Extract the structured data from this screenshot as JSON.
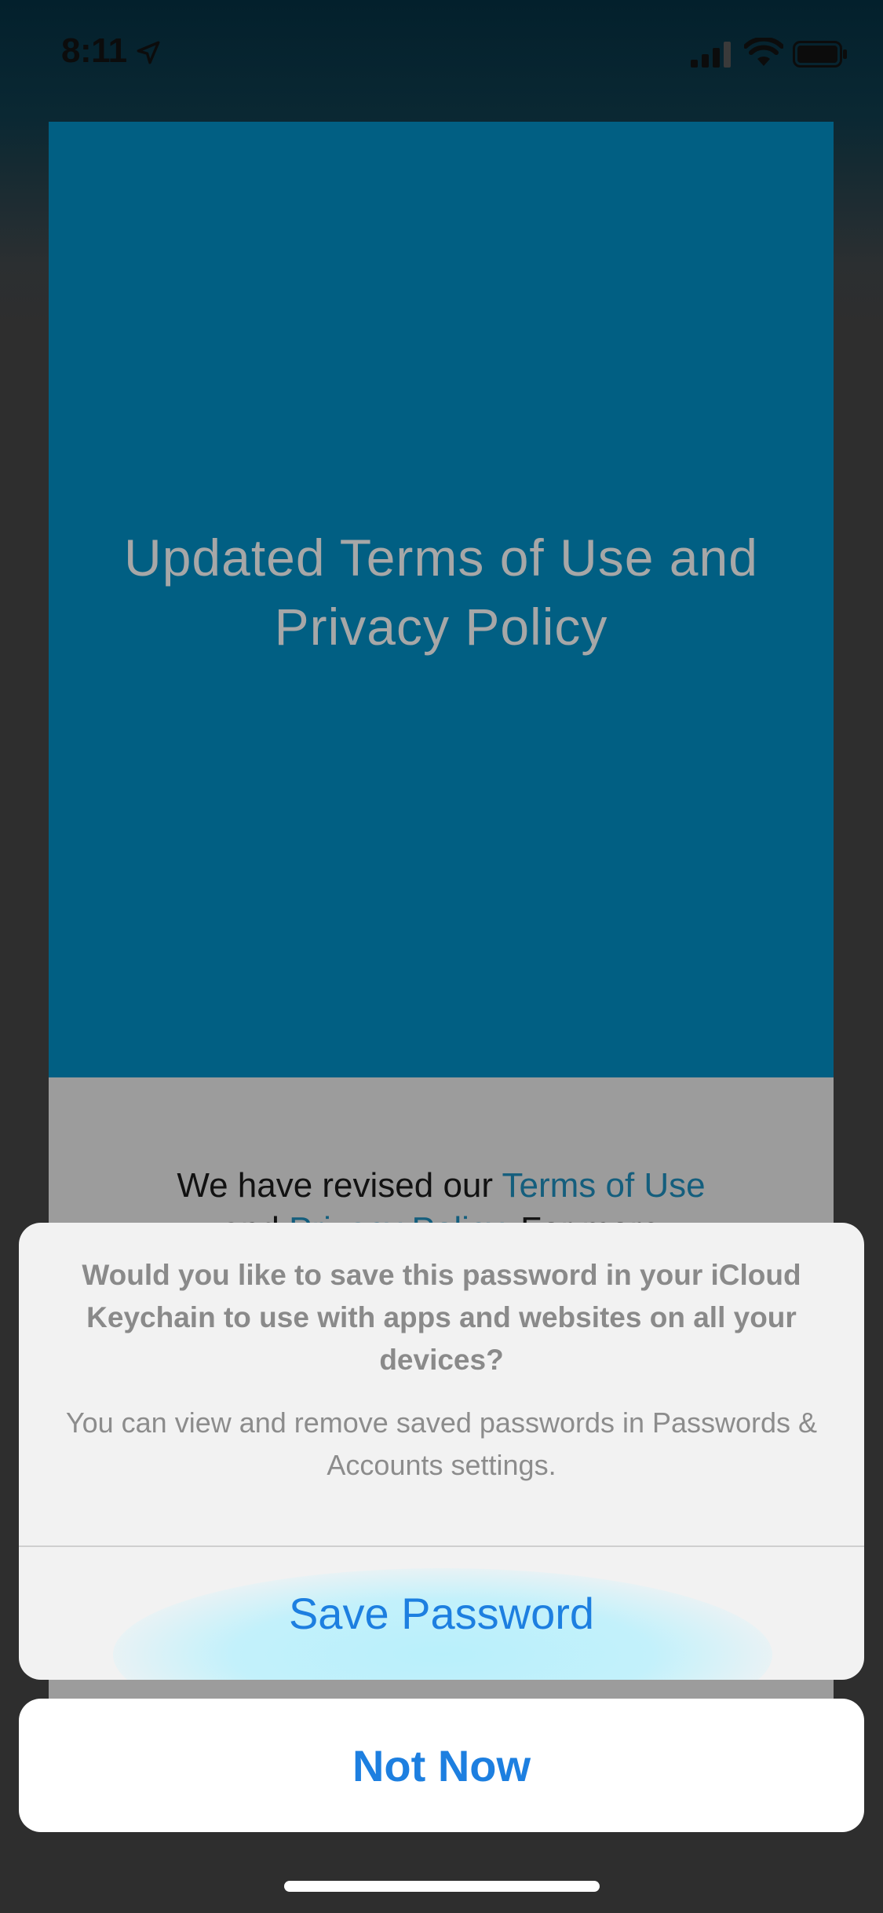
{
  "status_bar": {
    "time": "8:11",
    "icons": [
      "location-arrow-icon",
      "cellular-signal-icon",
      "wifi-icon",
      "battery-icon"
    ]
  },
  "hero": {
    "title": "Updated Terms of Use and Privacy Policy"
  },
  "body": {
    "text_prefix": "We have revised our ",
    "terms_link": "Terms of Use",
    "text_middle": " and ",
    "privacy_link": "Privacy Policy",
    "text_suffix": ". For more"
  },
  "alert": {
    "title": "Would you like to save this password in your iCloud Keychain to use with apps and websites on all your devices?",
    "message": "You can view and remove saved passwords in Passwords & Accounts settings.",
    "save_label": "Save Password",
    "cancel_label": "Not Now"
  },
  "colors": {
    "hero_blue": "#015f83",
    "link_blue": "#145e7d",
    "ios_action_blue": "#1d7fe0"
  }
}
